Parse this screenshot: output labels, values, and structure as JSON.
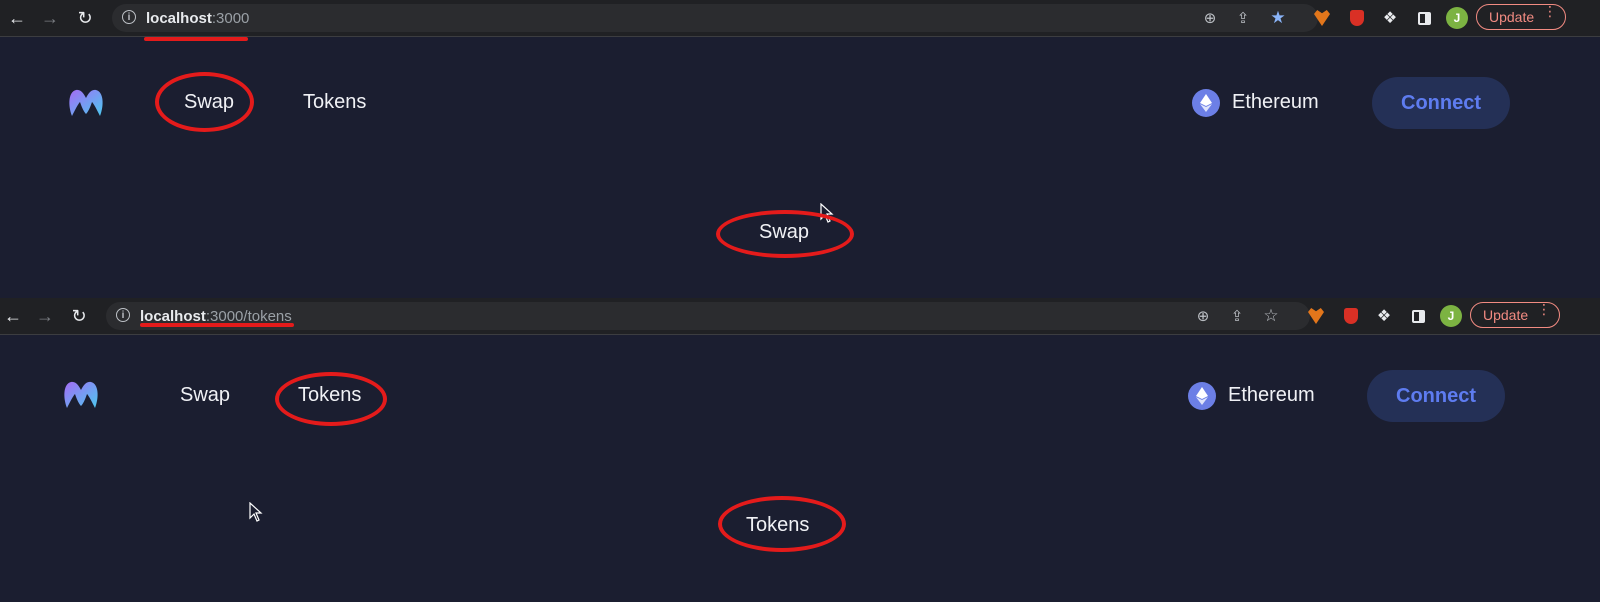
{
  "screens": [
    {
      "browser": {
        "url_host": "localhost",
        "url_rest": ":3000",
        "update_label": "Update",
        "profile_initial": "J",
        "bookmarked": true
      },
      "nav": {
        "links": [
          "Swap",
          "Tokens"
        ],
        "active": "Swap",
        "network_label": "Ethereum",
        "connect_label": "Connect"
      },
      "page_heading": "Swap"
    },
    {
      "browser": {
        "url_host": "localhost",
        "url_rest": ":3000/tokens",
        "update_label": "Update",
        "profile_initial": "J",
        "bookmarked": false
      },
      "nav": {
        "links": [
          "Swap",
          "Tokens"
        ],
        "active": "Tokens",
        "network_label": "Ethereum",
        "connect_label": "Connect"
      },
      "page_heading": "Tokens"
    }
  ],
  "colors": {
    "background": "#1b1e30",
    "annotation": "#e41b1b",
    "connect_bg": "#243056",
    "connect_text": "#5e7cf0",
    "eth_icon": "#6c7fe6",
    "logo_gradient": [
      "#a46cf5",
      "#4cc9f0"
    ]
  },
  "icons": [
    "back-icon",
    "forward-icon",
    "reload-icon",
    "info-icon",
    "zoom-icon",
    "share-icon",
    "star-icon",
    "metamask-icon",
    "shield-icon",
    "puzzle-icon",
    "sidepanel-icon",
    "ethereum-icon",
    "cursor-icon"
  ]
}
